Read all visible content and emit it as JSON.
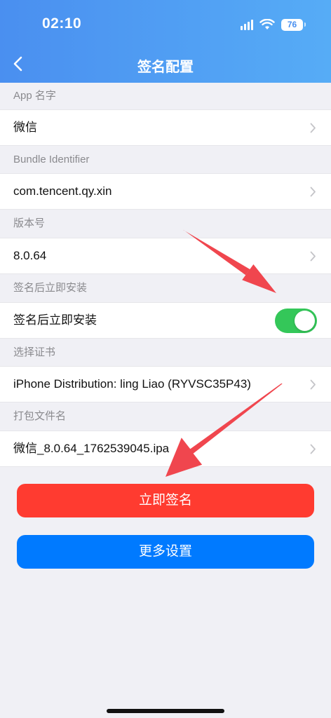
{
  "status_bar": {
    "time": "02:10",
    "battery": "76"
  },
  "nav": {
    "title": "签名配置"
  },
  "sections": [
    {
      "label": "App 名字",
      "value": "微信"
    },
    {
      "label": "Bundle Identifier",
      "value": "com.tencent.qy.xin"
    },
    {
      "label": "版本号",
      "value": "8.0.64"
    },
    {
      "label": "签名后立即安装",
      "value": "签名后立即安装",
      "toggle_on": true
    },
    {
      "label": "选择证书",
      "value": "iPhone Distribution: ling Liao (RYVSC35P43)"
    },
    {
      "label": "打包文件名",
      "value": "微信_8.0.64_1762539045.ipa"
    }
  ],
  "buttons": {
    "sign_now": "立即签名",
    "more_settings": "更多设置"
  },
  "colors": {
    "header_start": "#4a8ff0",
    "header_end": "#56acf6",
    "toggle": "#34c759",
    "sign_button": "#ff3b30",
    "settings_button": "#007aff",
    "annotation_arrow": "#f0464e"
  },
  "icons": [
    "back-chevron-icon",
    "signal-icon",
    "wifi-icon",
    "battery-icon",
    "chevron-right-icon"
  ]
}
